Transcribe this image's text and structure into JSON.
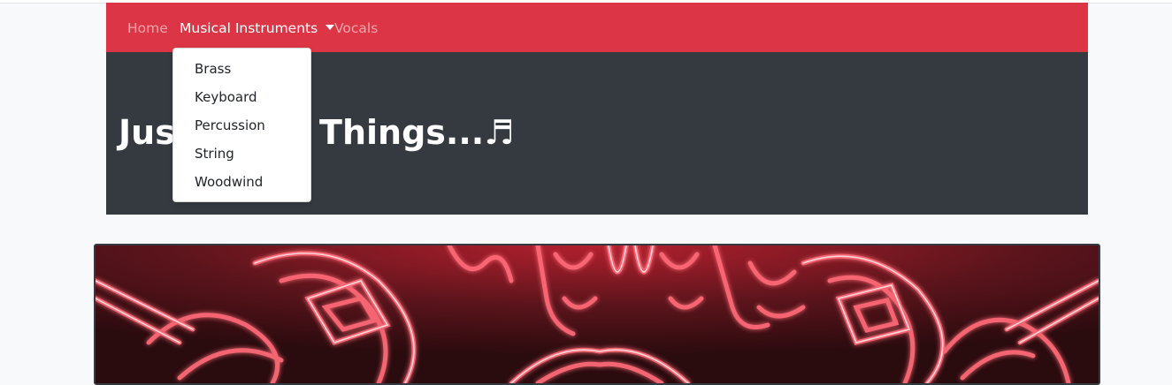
{
  "navbar": {
    "items": [
      {
        "label": "Home",
        "active": false
      },
      {
        "label": "Musical Instruments",
        "active": true,
        "has_dropdown": true
      },
      {
        "label": "Vocals",
        "active": false
      }
    ],
    "colors": {
      "background": "#dc3545",
      "link": "#ffffff"
    }
  },
  "dropdown": {
    "items": [
      "Brass",
      "Keyboard",
      "Percussion",
      "String",
      "Woodwind"
    ]
  },
  "hero": {
    "title": "Just Brass Things...♬",
    "background": "#343a40"
  },
  "banner": {
    "image_subject": "neon brass instruments sign",
    "colors": {
      "glow": "#ff4d5e",
      "core": "#ffd6da",
      "dark": "#3a0e12"
    }
  },
  "page": {
    "background": "#f8f9fa"
  }
}
